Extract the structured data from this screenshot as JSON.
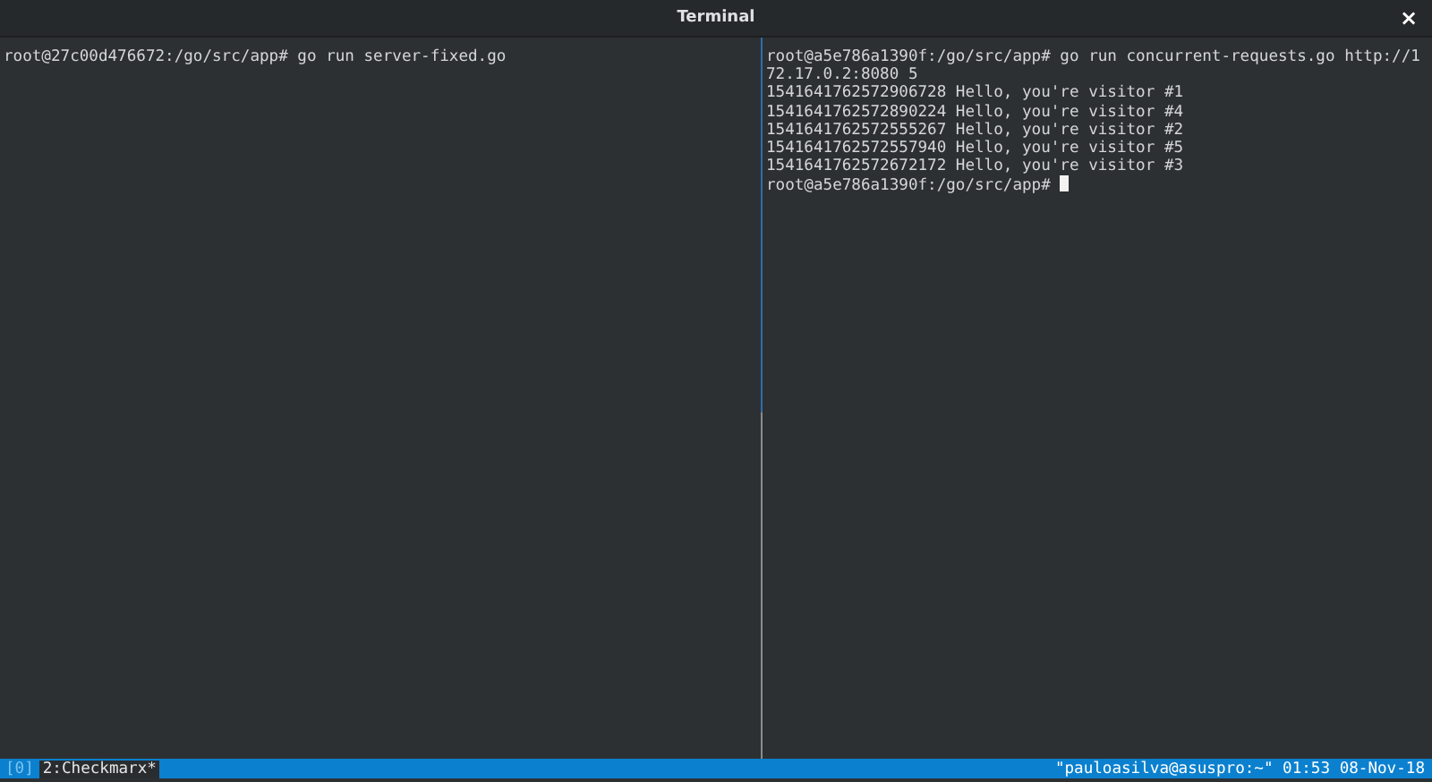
{
  "window": {
    "title": "Terminal",
    "close": "×"
  },
  "panes": [
    {
      "active": false,
      "lines": [
        "root@27c00d476672:/go/src/app# go run server-fixed.go"
      ]
    },
    {
      "active": true,
      "lines": [
        "root@a5e786a1390f:/go/src/app# go run concurrent-requests.go http://1",
        "72.17.0.2:8080 5",
        "1541641762572906728 Hello, you're visitor #1",
        "1541641762572890224 Hello, you're visitor #4",
        "1541641762572555267 Hello, you're visitor #2",
        "1541641762572557940 Hello, you're visitor #5",
        "1541641762572672172 Hello, you're visitor #3",
        "root@a5e786a1390f:/go/src/app# "
      ]
    }
  ],
  "status_bar": {
    "session": "[0]",
    "windows": [
      {
        "label": "2:Checkmarx*",
        "selected": true
      }
    ],
    "right": "\"pauloasilva@asuspro:~\" 01:53 08-Nov-18"
  }
}
